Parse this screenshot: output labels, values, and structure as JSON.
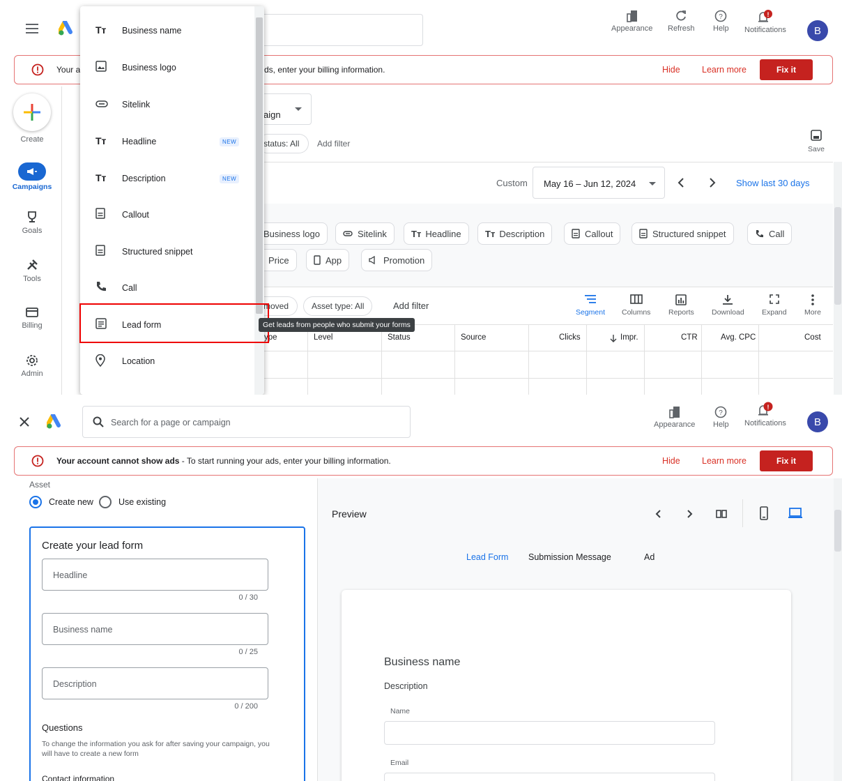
{
  "top": {
    "header": {
      "appearance": "Appearance",
      "refresh": "Refresh",
      "help": "Help",
      "notifications": "Notifications",
      "avatar_letter": "B"
    },
    "banner": {
      "text_partial": "Your a",
      "text_rest": "ds, enter your billing information.",
      "hide": "Hide",
      "learn_more": "Learn more",
      "fix_it": "Fix it"
    },
    "nav": {
      "create": "Create",
      "campaigns": "Campaigns",
      "goals": "Goals",
      "tools": "Tools",
      "billing": "Billing",
      "admin": "Admin"
    },
    "campaign_select_partial": "aign",
    "filter": {
      "status": "status: All",
      "add_filter": "Add filter"
    },
    "save": "Save",
    "date": {
      "custom": "Custom",
      "range": "May 16 – Jun 12, 2024",
      "show_last": "Show last 30 days"
    },
    "asset_chips_row1": [
      "Business logo",
      "Sitelink",
      "Headline",
      "Description",
      "Callout",
      "Structured snippet",
      "Call"
    ],
    "asset_chips_row2": [
      "Price",
      "App",
      "Promotion"
    ],
    "table_filter": {
      "removed": "moved",
      "asset_type": "Asset type: All",
      "add_filter": "Add filter"
    },
    "toolbar": [
      "Segment",
      "Columns",
      "Reports",
      "Download",
      "Expand",
      "More"
    ],
    "columns": [
      "ype",
      "Level",
      "Status",
      "Source",
      "Clicks",
      "Impr.",
      "CTR",
      "Avg. CPC",
      "Cost"
    ],
    "menu": {
      "items": [
        {
          "label": "Business name",
          "icon": "text-icon",
          "new": ""
        },
        {
          "label": "Business logo",
          "icon": "image-icon",
          "new": ""
        },
        {
          "label": "Sitelink",
          "icon": "link-icon",
          "new": ""
        },
        {
          "label": "Headline",
          "icon": "text-icon",
          "new": "NEW"
        },
        {
          "label": "Description",
          "icon": "text-icon",
          "new": "NEW"
        },
        {
          "label": "Callout",
          "icon": "doc-icon",
          "new": ""
        },
        {
          "label": "Structured snippet",
          "icon": "doc-icon",
          "new": ""
        },
        {
          "label": "Call",
          "icon": "phone-icon",
          "new": ""
        },
        {
          "label": "Lead form",
          "icon": "form-icon",
          "new": ""
        },
        {
          "label": "Location",
          "icon": "location-icon",
          "new": ""
        }
      ],
      "tooltip": "Get leads from people who submit your forms"
    }
  },
  "bottom": {
    "search_placeholder": "Search for a page or campaign",
    "header": {
      "appearance": "Appearance",
      "help": "Help",
      "notifications": "Notifications",
      "avatar_letter": "B"
    },
    "banner": {
      "bold": "Your account cannot show ads",
      "text": " - To start running your ads, enter your billing information.",
      "hide": "Hide",
      "learn_more": "Learn more",
      "fix_it": "Fix it"
    },
    "asset_label": "Asset",
    "create_new": "Create new",
    "use_existing": "Use existing",
    "form_title": "Create your lead form",
    "fields": [
      {
        "placeholder": "Headline",
        "counter": "0 / 30"
      },
      {
        "placeholder": "Business name",
        "counter": "0 / 25"
      },
      {
        "placeholder": "Description",
        "counter": "0 / 200"
      }
    ],
    "questions_title": "Questions",
    "questions_note": "To change the information you ask for after saving your campaign, you will have to create a new form",
    "contact_info": "Contact information",
    "preview": {
      "title": "Preview",
      "tabs": [
        "Lead Form",
        "Submission Message",
        "Ad"
      ],
      "business_name": "Business name",
      "description": "Description",
      "name_label": "Name",
      "email_label": "Email"
    }
  }
}
